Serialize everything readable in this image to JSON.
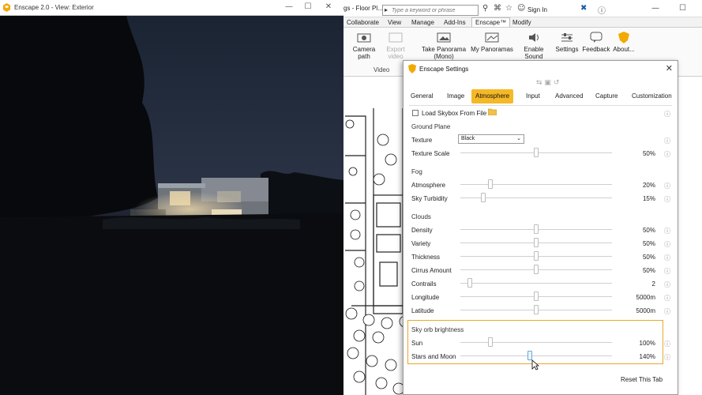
{
  "enscape": {
    "title": "Enscape 2.0 - View: Exterior",
    "controls": {
      "minimize": "—",
      "maximize": "☐",
      "close": "✕"
    }
  },
  "revit": {
    "doc_title": "gs - Floor Pl...",
    "search_placeholder": "Type a keyword or phrase",
    "signin": "Sign In",
    "tabs": [
      "Collaborate",
      "View",
      "Manage",
      "Add-Ins",
      "Enscape™",
      "Modify"
    ],
    "active_tab": "Enscape™",
    "buttons": {
      "camera_path": "Camera path",
      "export_video": "Export video",
      "take_panorama": "Take Panorama (Mono)",
      "my_panoramas": "My Panoramas",
      "enable_sound": "Enable Sound",
      "settings": "Settings",
      "feedback": "Feedback",
      "about": "About..."
    },
    "video_group_label": "Video"
  },
  "settings": {
    "title": "Enscape Settings",
    "tabs": [
      "General",
      "Image",
      "Atmosphere",
      "Input",
      "Advanced",
      "Capture",
      "Customization"
    ],
    "active_tab": "Atmosphere",
    "load_skybox_label": "Load Skybox From File",
    "load_skybox_checked": false,
    "ground_plane": {
      "heading": "Ground Plane",
      "texture_label": "Texture",
      "texture_value": "Black",
      "texture_scale_label": "Texture Scale",
      "texture_scale_value": "50%",
      "texture_scale_level": 0.5
    },
    "fog": {
      "heading": "Fog",
      "rows": [
        {
          "label": "Atmosphere",
          "value": "20%",
          "level": 0.2
        },
        {
          "label": "Sky Turbidity",
          "value": "15%",
          "level": 0.15
        }
      ]
    },
    "clouds": {
      "heading": "Clouds",
      "rows": [
        {
          "label": "Density",
          "value": "50%",
          "level": 0.5
        },
        {
          "label": "Variety",
          "value": "50%",
          "level": 0.5
        },
        {
          "label": "Thickness",
          "value": "50%",
          "level": 0.5
        },
        {
          "label": "Cirrus Amount",
          "value": "50%",
          "level": 0.5
        },
        {
          "label": "Contrails",
          "value": "2",
          "level": 0.06
        },
        {
          "label": "Longitude",
          "value": "5000m",
          "level": 0.5
        },
        {
          "label": "Latitude",
          "value": "5000m",
          "level": 0.5
        }
      ]
    },
    "sky_orb": {
      "heading": "Sky orb brightness",
      "rows": [
        {
          "label": "Sun",
          "value": "100%",
          "level": 0.2
        },
        {
          "label": "Stars and Moon",
          "value": "140%",
          "level": 0.46
        }
      ]
    },
    "reset_label": "Reset This Tab"
  },
  "colors": {
    "accent": "#f5b826",
    "orb_box_border": "#e8a82a"
  }
}
